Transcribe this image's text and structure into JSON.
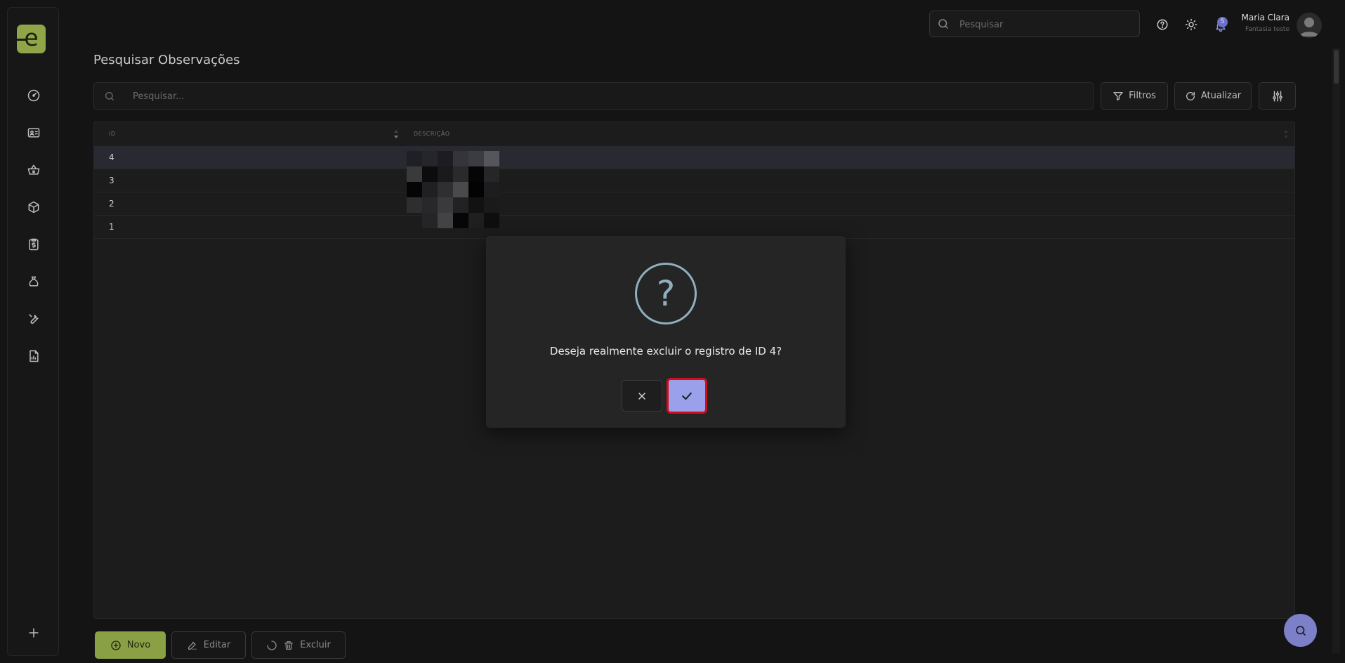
{
  "header": {
    "search_placeholder": "Pesquisar",
    "notification_count": "5",
    "user_name": "Maria Clara",
    "user_company": "Fantasia teste"
  },
  "sidebar": {
    "logo_letter": "e",
    "items": [
      {
        "icon": "dashboard-gauge-icon"
      },
      {
        "icon": "id-card-icon"
      },
      {
        "icon": "shopping-basket-icon"
      },
      {
        "icon": "package-box-icon"
      },
      {
        "icon": "invoice-dollar-icon"
      },
      {
        "icon": "money-bag-icon"
      },
      {
        "icon": "wrench-icon"
      },
      {
        "icon": "report-chart-icon"
      }
    ],
    "add_icon": "plus-icon"
  },
  "page": {
    "title": "Pesquisar Observações"
  },
  "toolbar": {
    "search_placeholder": "Pesquisar...",
    "filters_label": "Filtros",
    "refresh_label": "Atualizar"
  },
  "table": {
    "columns": [
      "ID",
      "DESCRIÇÃO"
    ],
    "rows": [
      {
        "id": "4",
        "selected": true
      },
      {
        "id": "3",
        "selected": false
      },
      {
        "id": "2",
        "selected": false
      },
      {
        "id": "1",
        "selected": false
      }
    ]
  },
  "dialog": {
    "message": "Deseja realmente excluir o registro de ID 4?",
    "icon": "question-circle-icon",
    "confirm_highlight_color": "#d40d18"
  },
  "actions": {
    "new_label": "Novo",
    "edit_label": "Editar",
    "delete_label": "Excluir"
  },
  "colors": {
    "brand_green": "#8fa547",
    "accent_purple": "#9aa0ea"
  }
}
